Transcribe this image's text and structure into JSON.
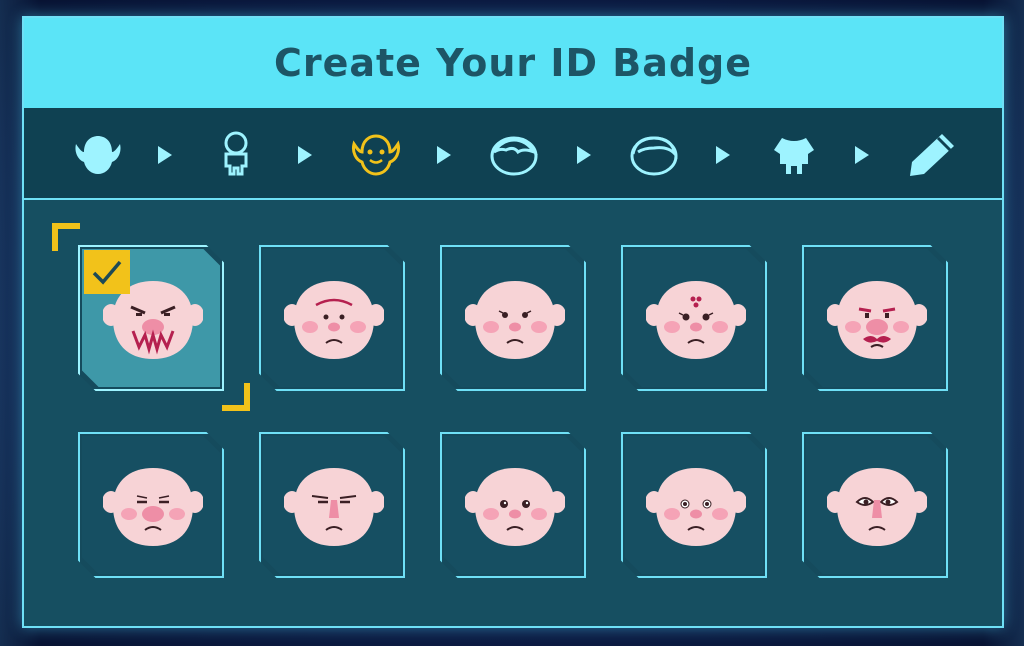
{
  "title": "Create Your ID Badge",
  "steps": [
    {
      "icon": "head-shape-icon",
      "active": false
    },
    {
      "icon": "body-outline-icon",
      "active": false
    },
    {
      "icon": "face-icon",
      "active": true
    },
    {
      "icon": "hair-front-icon",
      "active": false
    },
    {
      "icon": "hair-back-icon",
      "active": false
    },
    {
      "icon": "outfit-icon",
      "active": false
    },
    {
      "icon": "pencil-icon",
      "active": false
    }
  ],
  "colors": {
    "title_bar": "#5be4f7",
    "title_text": "#1d5566",
    "panel": "#154e60",
    "accent_selected": "#f2c21a",
    "step_active": "#f2c21a",
    "step_inactive": "#9ef3ff",
    "skin": "#f7d3d6",
    "cheek": "#f5a3b6",
    "nose": "#ee8ea6"
  },
  "faces": [
    {
      "name": "face-option-1",
      "selected": true
    },
    {
      "name": "face-option-2",
      "selected": false
    },
    {
      "name": "face-option-3",
      "selected": false
    },
    {
      "name": "face-option-4",
      "selected": false
    },
    {
      "name": "face-option-5",
      "selected": false
    },
    {
      "name": "face-option-6",
      "selected": false
    },
    {
      "name": "face-option-7",
      "selected": false
    },
    {
      "name": "face-option-8",
      "selected": false
    },
    {
      "name": "face-option-9",
      "selected": false
    },
    {
      "name": "face-option-10",
      "selected": false
    }
  ],
  "selection_icon": "checkmark-icon"
}
